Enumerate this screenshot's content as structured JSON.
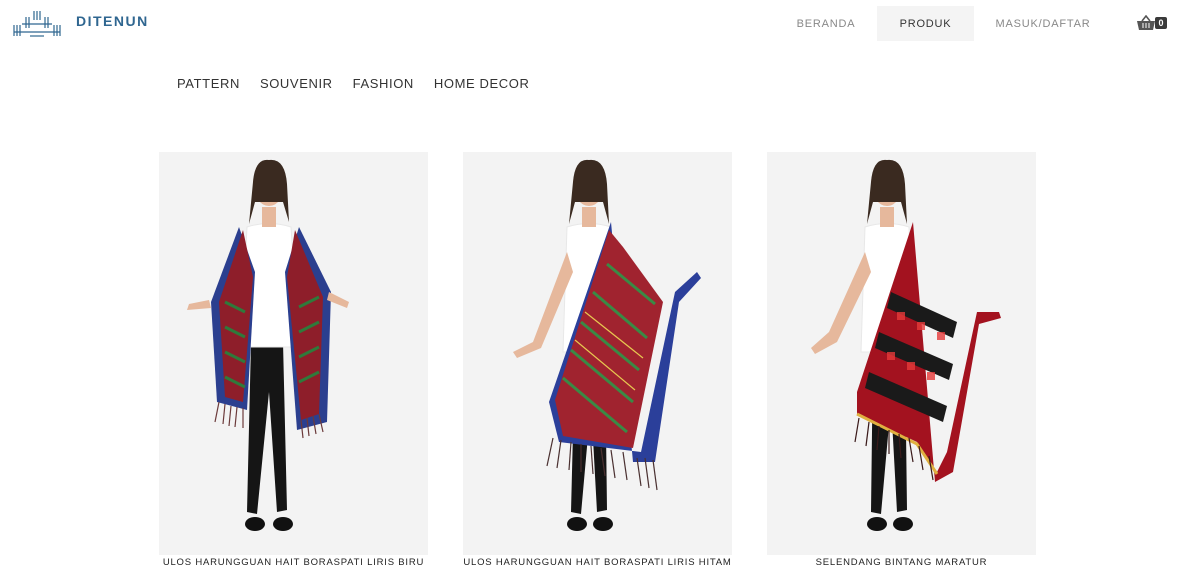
{
  "brand": {
    "name": "DITENUN"
  },
  "nav": {
    "items": [
      {
        "label": "BERANDA"
      },
      {
        "label": "PRODUK",
        "active": true
      },
      {
        "label": "MASUK/DAFTAR"
      }
    ]
  },
  "cart": {
    "count": "0",
    "icon": "basket-icon"
  },
  "categories": [
    "PATTERN",
    "SOUVENIR",
    "FASHION",
    "HOME DECOR"
  ],
  "products": [
    {
      "name": "ULOS HARUNGGUAN HAIT BORASPATI LIRIS BIRU",
      "shawl_colors": [
        "#2b3f8f",
        "#8e1e2a",
        "#2f7a3b"
      ]
    },
    {
      "name": "ULOS HARUNGGUAN HAIT BORASPATI LIRIS HITAM",
      "shawl_colors": [
        "#2b3f9a",
        "#a0232f",
        "#3a8a45"
      ]
    },
    {
      "name": "SELENDANG BINTANG MARATUR",
      "shawl_colors": [
        "#a3121f",
        "#1a1a1a",
        "#e63a3a"
      ]
    }
  ],
  "colors": {
    "brand": "#2f6690",
    "active_nav_bg": "#f4f4f4"
  }
}
